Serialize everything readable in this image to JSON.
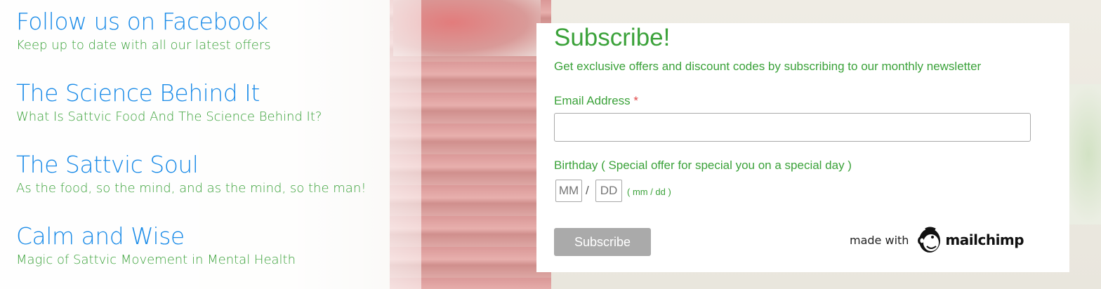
{
  "links": [
    {
      "title": "Follow us on Facebook",
      "subtitle": "Keep up to date with all our latest offers"
    },
    {
      "title": "The Science Behind It",
      "subtitle": "What Is Sattvic Food And The Science Behind It?"
    },
    {
      "title": "The Sattvic Soul",
      "subtitle": "As the food, so the mind, and as the mind, so the man!"
    },
    {
      "title": "Calm and Wise",
      "subtitle": "Magic of Sattvic Movement in Mental Health"
    }
  ],
  "form": {
    "heading": "Subscribe!",
    "intro": "Get exclusive offers and discount codes by subscribing to our monthly newsletter",
    "email_label": "Email Address",
    "required_mark": "*",
    "email_value": "",
    "birthday_label": "Birthday ( Special offer for special you on a special day )",
    "month_placeholder": "MM",
    "day_placeholder": "DD",
    "separator": "/",
    "format_hint": "( mm / dd )",
    "submit_label": "Subscribe"
  },
  "badge": {
    "made_with": "made with",
    "brand": "mailchimp",
    "icon": "mailchimp-logo-icon"
  },
  "colors": {
    "link_blue": "#1a8be8",
    "brand_green": "#3ba23a",
    "required_red": "#e04848",
    "button_gray": "#aaaaaa"
  }
}
